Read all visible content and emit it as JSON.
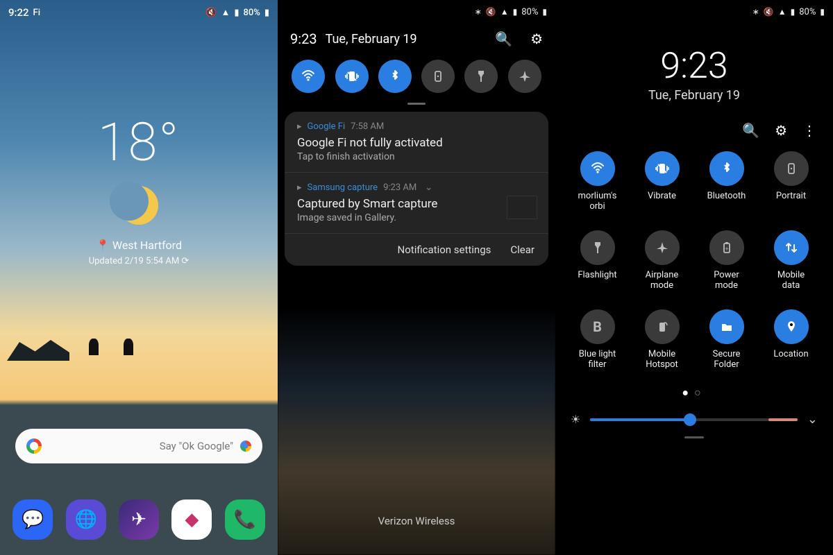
{
  "panelA": {
    "status": {
      "time": "9:22",
      "battery": "80%"
    },
    "weather": {
      "temp": "18°",
      "location": "West Hartford",
      "updated": "Updated 2/19 5:54 AM ⟳"
    },
    "search_hint": "Say \"Ok Google\"",
    "dock": [
      "messages",
      "browser",
      "rocket",
      "music",
      "phone"
    ]
  },
  "panelB": {
    "status": {
      "battery": "80%"
    },
    "header": {
      "time": "9:23",
      "date": "Tue, February 19"
    },
    "quick": [
      {
        "name": "wifi",
        "glyph": "wifi",
        "on": true
      },
      {
        "name": "vibrate",
        "glyph": "vibe",
        "on": true
      },
      {
        "name": "bluetooth",
        "glyph": "bt",
        "on": true
      },
      {
        "name": "rotation",
        "glyph": "rot",
        "on": false
      },
      {
        "name": "flashlight",
        "glyph": "flash",
        "on": false
      },
      {
        "name": "airplane",
        "glyph": "plane",
        "on": false
      }
    ],
    "notifs": [
      {
        "app": "Google Fi",
        "time": "7:58 AM",
        "title": "Google Fi not fully activated",
        "body": "Tap to finish activation",
        "thumb": false,
        "chev": false
      },
      {
        "app": "Samsung capture",
        "time": "9:23 AM",
        "title": "Captured by Smart capture",
        "body": "Image saved in Gallery.",
        "thumb": true,
        "chev": true
      }
    ],
    "footer": {
      "settings": "Notification settings",
      "clear": "Clear"
    },
    "carrier": "Verizon Wireless"
  },
  "panelC": {
    "status": {
      "battery": "80%"
    },
    "clock": {
      "time": "9:23",
      "date": "Tue, February 19"
    },
    "toggles": [
      {
        "name": "wifi",
        "label": "morlium's\norbi",
        "glyph": "wifi",
        "on": true
      },
      {
        "name": "vibrate",
        "label": "Vibrate",
        "glyph": "vibe",
        "on": true
      },
      {
        "name": "bluetooth",
        "label": "Bluetooth",
        "glyph": "bt",
        "on": true
      },
      {
        "name": "portrait",
        "label": "Portrait",
        "glyph": "rot",
        "on": false
      },
      {
        "name": "flashlight",
        "label": "Flashlight",
        "glyph": "flash",
        "on": false
      },
      {
        "name": "airplane",
        "label": "Airplane\nmode",
        "glyph": "plane",
        "on": false
      },
      {
        "name": "power",
        "label": "Power\nmode",
        "glyph": "batt",
        "on": false
      },
      {
        "name": "mobiledata",
        "label": "Mobile\ndata",
        "glyph": "data",
        "on": true
      },
      {
        "name": "bluelight",
        "label": "Blue light\nfilter",
        "glyph": "B",
        "on": false
      },
      {
        "name": "hotspot",
        "label": "Mobile\nHotspot",
        "glyph": "hot",
        "on": false
      },
      {
        "name": "secure",
        "label": "Secure\nFolder",
        "glyph": "folder",
        "on": true
      },
      {
        "name": "location",
        "label": "Location",
        "glyph": "pin",
        "on": true
      }
    ]
  }
}
